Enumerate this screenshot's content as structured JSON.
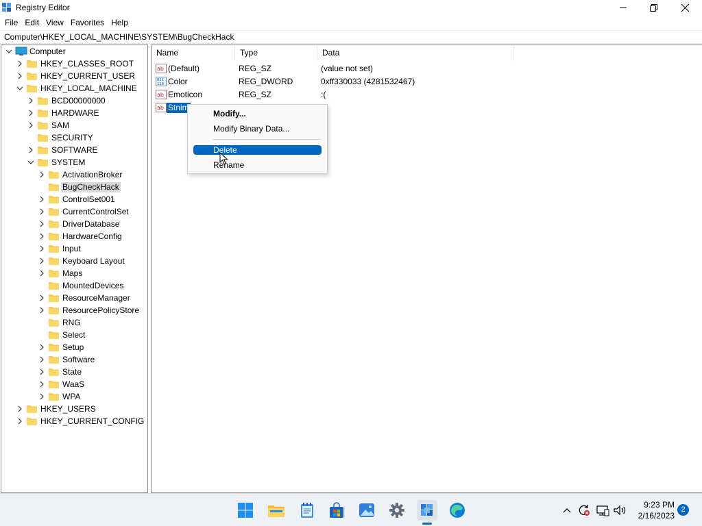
{
  "window": {
    "title": "Registry Editor",
    "controls": {
      "minimize": "minimize",
      "maximize": "maximize",
      "close": "close"
    }
  },
  "menu": [
    "File",
    "Edit",
    "View",
    "Favorites",
    "Help"
  ],
  "address": "Computer\\HKEY_LOCAL_MACHINE\\SYSTEM\\BugCheckHack",
  "tree": {
    "root": "Computer",
    "nodes": [
      {
        "label": "HKEY_CLASSES_ROOT",
        "level": 1,
        "expander": "collapsed"
      },
      {
        "label": "HKEY_CURRENT_USER",
        "level": 1,
        "expander": "collapsed"
      },
      {
        "label": "HKEY_LOCAL_MACHINE",
        "level": 1,
        "expander": "expanded"
      },
      {
        "label": "BCD00000000",
        "level": 2,
        "expander": "collapsed"
      },
      {
        "label": "HARDWARE",
        "level": 2,
        "expander": "collapsed"
      },
      {
        "label": "SAM",
        "level": 2,
        "expander": "collapsed"
      },
      {
        "label": "SECURITY",
        "level": 2,
        "expander": "none"
      },
      {
        "label": "SOFTWARE",
        "level": 2,
        "expander": "collapsed"
      },
      {
        "label": "SYSTEM",
        "level": 2,
        "expander": "expanded"
      },
      {
        "label": "ActivationBroker",
        "level": 3,
        "expander": "collapsed"
      },
      {
        "label": "BugCheckHack",
        "level": 3,
        "expander": "none",
        "selected": true
      },
      {
        "label": "ControlSet001",
        "level": 3,
        "expander": "collapsed"
      },
      {
        "label": "CurrentControlSet",
        "level": 3,
        "expander": "collapsed"
      },
      {
        "label": "DriverDatabase",
        "level": 3,
        "expander": "collapsed"
      },
      {
        "label": "HardwareConfig",
        "level": 3,
        "expander": "collapsed"
      },
      {
        "label": "Input",
        "level": 3,
        "expander": "collapsed"
      },
      {
        "label": "Keyboard Layout",
        "level": 3,
        "expander": "collapsed"
      },
      {
        "label": "Maps",
        "level": 3,
        "expander": "collapsed"
      },
      {
        "label": "MountedDevices",
        "level": 3,
        "expander": "none"
      },
      {
        "label": "ResourceManager",
        "level": 3,
        "expander": "collapsed"
      },
      {
        "label": "ResourcePolicyStore",
        "level": 3,
        "expander": "collapsed"
      },
      {
        "label": "RNG",
        "level": 3,
        "expander": "none"
      },
      {
        "label": "Select",
        "level": 3,
        "expander": "none"
      },
      {
        "label": "Setup",
        "level": 3,
        "expander": "collapsed"
      },
      {
        "label": "Software",
        "level": 3,
        "expander": "collapsed"
      },
      {
        "label": "State",
        "level": 3,
        "expander": "collapsed"
      },
      {
        "label": "WaaS",
        "level": 3,
        "expander": "collapsed"
      },
      {
        "label": "WPA",
        "level": 3,
        "expander": "collapsed"
      },
      {
        "label": "HKEY_USERS",
        "level": 1,
        "expander": "collapsed"
      },
      {
        "label": "HKEY_CURRENT_CONFIG",
        "level": 1,
        "expander": "collapsed"
      }
    ]
  },
  "list": {
    "columns": [
      "Name",
      "Type",
      "Data"
    ],
    "rows": [
      {
        "icon": "string-value-icon",
        "name": "(Default)",
        "type": "REG_SZ",
        "data": "(value not set)"
      },
      {
        "icon": "binary-value-icon",
        "name": "Color",
        "type": "REG_DWORD",
        "data": "0xff330033 (4281532467)"
      },
      {
        "icon": "string-value-icon",
        "name": "Emoticon",
        "type": "REG_SZ",
        "data": ":("
      },
      {
        "icon": "string-value-icon",
        "name": "Stnim",
        "type": "",
        "data": "",
        "selected": true
      }
    ]
  },
  "context_menu": {
    "items": [
      "Modify...",
      "Modify Binary Data...",
      "Delete",
      "Rename"
    ],
    "highlighted": "Delete"
  },
  "taskbar": {
    "apps": [
      "start-icon",
      "file-explorer-icon",
      "notepad-icon",
      "store-icon",
      "photos-icon",
      "settings-icon",
      "registry-editor-icon",
      "edge-icon"
    ],
    "active": "registry-editor-icon",
    "time": "9:23 PM",
    "date": "2/16/2023",
    "notification_count": "2"
  },
  "colors": {
    "accent": "#0067c0",
    "folder": "#f8c94a",
    "selection_gray": "#d9d9d9"
  }
}
